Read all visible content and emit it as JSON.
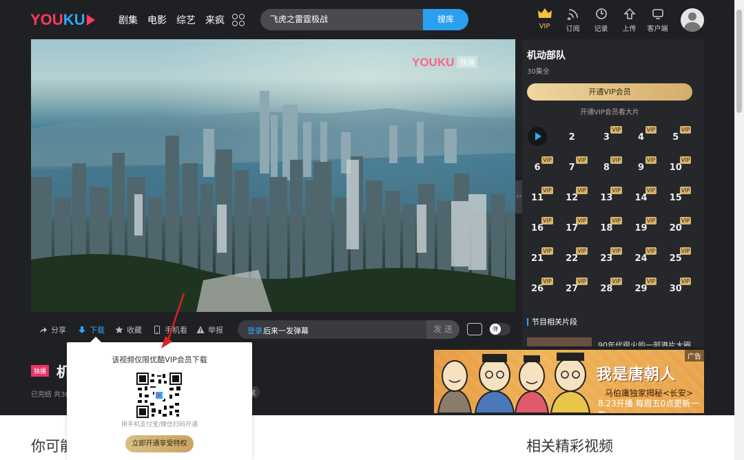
{
  "header": {
    "logo_text_a": "YOU",
    "logo_text_b": "KU",
    "nav": [
      "剧集",
      "电影",
      "综艺",
      "来疯"
    ],
    "search_value": "飞虎之雷霆极战",
    "search_button": "搜库",
    "icons": [
      {
        "name": "vip-crown-icon",
        "label": "VIP"
      },
      {
        "name": "subscribe-icon",
        "label": "订阅"
      },
      {
        "name": "history-icon",
        "label": "记录"
      },
      {
        "name": "upload-icon",
        "label": "上传"
      },
      {
        "name": "client-icon",
        "label": "客户端"
      }
    ]
  },
  "player": {
    "watermark": "YOUKU",
    "watermark_tag": "独播"
  },
  "controls": {
    "share": "分享",
    "download": "下载",
    "favorite": "收藏",
    "mobile": "手机看",
    "report": "举报",
    "danmu_login": "登录",
    "danmu_text": "后来一发弹幕",
    "danmu_send": "发 送",
    "danmu_toggle": "弹"
  },
  "panel": {
    "title": "机动部队",
    "episodes_total": "30集全",
    "vip_button": "开通VIP会员",
    "vip_note": "开通VIP会员看大片",
    "vip_badge": "VIP",
    "episodes": [
      "1",
      "2",
      "3",
      "4",
      "5",
      "6",
      "7",
      "8",
      "9",
      "10",
      "11",
      "12",
      "13",
      "14",
      "15",
      "16",
      "17",
      "18",
      "19",
      "20",
      "21",
      "22",
      "23",
      "24",
      "25",
      "26",
      "27",
      "28",
      "29",
      "30"
    ],
    "clips_title": "节目相关片段",
    "clip_text": "90年代很火的一部港片大圈"
  },
  "below": {
    "exclusive_badge": "独播",
    "show_title": "机动部队",
    "meta": "已完结 共30",
    "meta_chip": "案"
  },
  "ad": {
    "tag": "广告",
    "headline": "我是唐朝人",
    "line1": "马伯庸独家揭秘<长安>",
    "line2": "8.23开播 每周五0点更新一集"
  },
  "popup": {
    "title": "该视频仅限优酷VIP会员下载",
    "hint": "用手机支付宝/微信扫码开通",
    "button": "立即开通享受特权"
  },
  "sections": {
    "left": "你可能",
    "right": "相关精彩视频"
  },
  "colors": {
    "accent_blue": "#2aa9ff",
    "youku_pink": "#ff3a5c",
    "vip_gold": "#d8b46e"
  }
}
